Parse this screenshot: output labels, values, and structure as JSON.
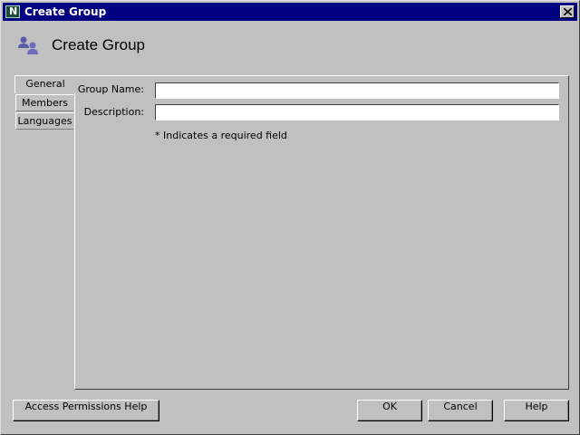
{
  "window": {
    "title": "Create Group",
    "app_icon_letter": "N"
  },
  "header": {
    "title": "Create Group",
    "icon": "group-icon"
  },
  "tabs": [
    {
      "label": "General",
      "active": true
    },
    {
      "label": "Members",
      "active": false
    },
    {
      "label": "Languages",
      "active": false
    }
  ],
  "form": {
    "group_name_label": "* Group Name:",
    "group_name_value": "",
    "description_label": "Description:",
    "description_value": "",
    "required_note": "* Indicates a required field"
  },
  "buttons": {
    "access_help": "Access Permissions Help",
    "ok": "OK",
    "cancel": "Cancel",
    "help": "Help"
  },
  "colors": {
    "titlebar": "#000080",
    "background": "#c0c0c0",
    "icon_accent": "#5a5aa8"
  }
}
